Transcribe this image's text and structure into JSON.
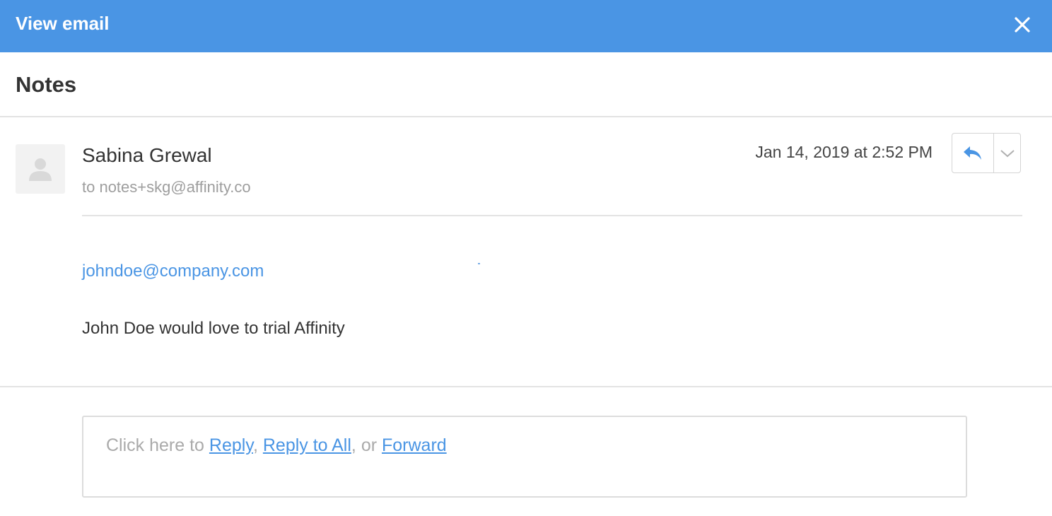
{
  "window": {
    "title": "View email",
    "close_icon": "close-icon",
    "header_color": "#4a95e4"
  },
  "email": {
    "subject": "Notes",
    "sender_name": "Sabina Grewal",
    "recipient": "to notes+skg@affinity.co",
    "timestamp": "Jan 14, 2019 at 2:52 PM",
    "avatar_icon": "user-placeholder-icon",
    "body_link": "johndoe@company.com",
    "body_text": "John Doe would love to trial Affinity"
  },
  "actions": {
    "reply_icon": "reply-arrow-icon",
    "more_icon": "chevron-down-icon"
  },
  "reply_box": {
    "prefix": "Click here to ",
    "reply_label": "Reply",
    "separator": ", ",
    "reply_all_label": "Reply to All",
    "or_text": ", or ",
    "forward_label": "Forward"
  }
}
